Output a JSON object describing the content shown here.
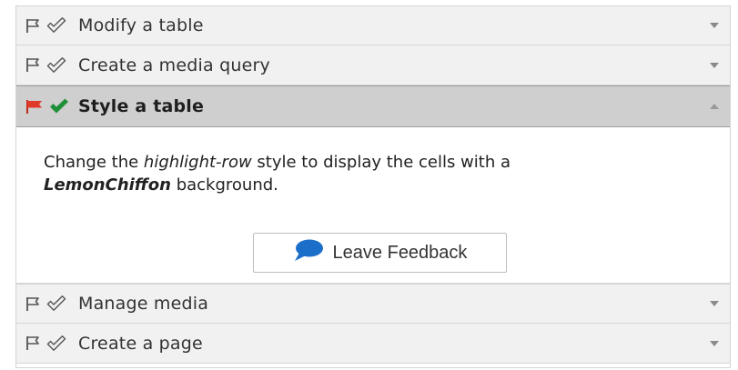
{
  "tasks": [
    {
      "title": "Modify a table",
      "state": "collapsed"
    },
    {
      "title": "Create a media query",
      "state": "collapsed"
    },
    {
      "title": "Style a table",
      "state": "expanded"
    },
    {
      "title": "Manage media",
      "state": "collapsed"
    },
    {
      "title": "Create a page",
      "state": "collapsed"
    }
  ],
  "active_task": {
    "instruction": {
      "part1": "Change the ",
      "em1": "highlight-row",
      "part2": " style to display the cells with a ",
      "strong1": "LemonChiffon",
      "part3": " background."
    },
    "feedback_label": "Leave Feedback"
  },
  "icons": {
    "flag_outline": "flag-outline-icon",
    "check_outline": "check-outline-icon",
    "flag_active": "flag-red-icon",
    "check_active": "check-green-icon",
    "expand": "chevron-down-icon",
    "collapse": "chevron-up-icon",
    "feedback": "speech-bubble-icon"
  },
  "colors": {
    "flag_active": "#e03a2b",
    "check_active": "#1f8f3a",
    "bubble": "#1c6fc9",
    "active_header_bg": "#cfcfcf",
    "header_bg": "#f1f1f1"
  }
}
